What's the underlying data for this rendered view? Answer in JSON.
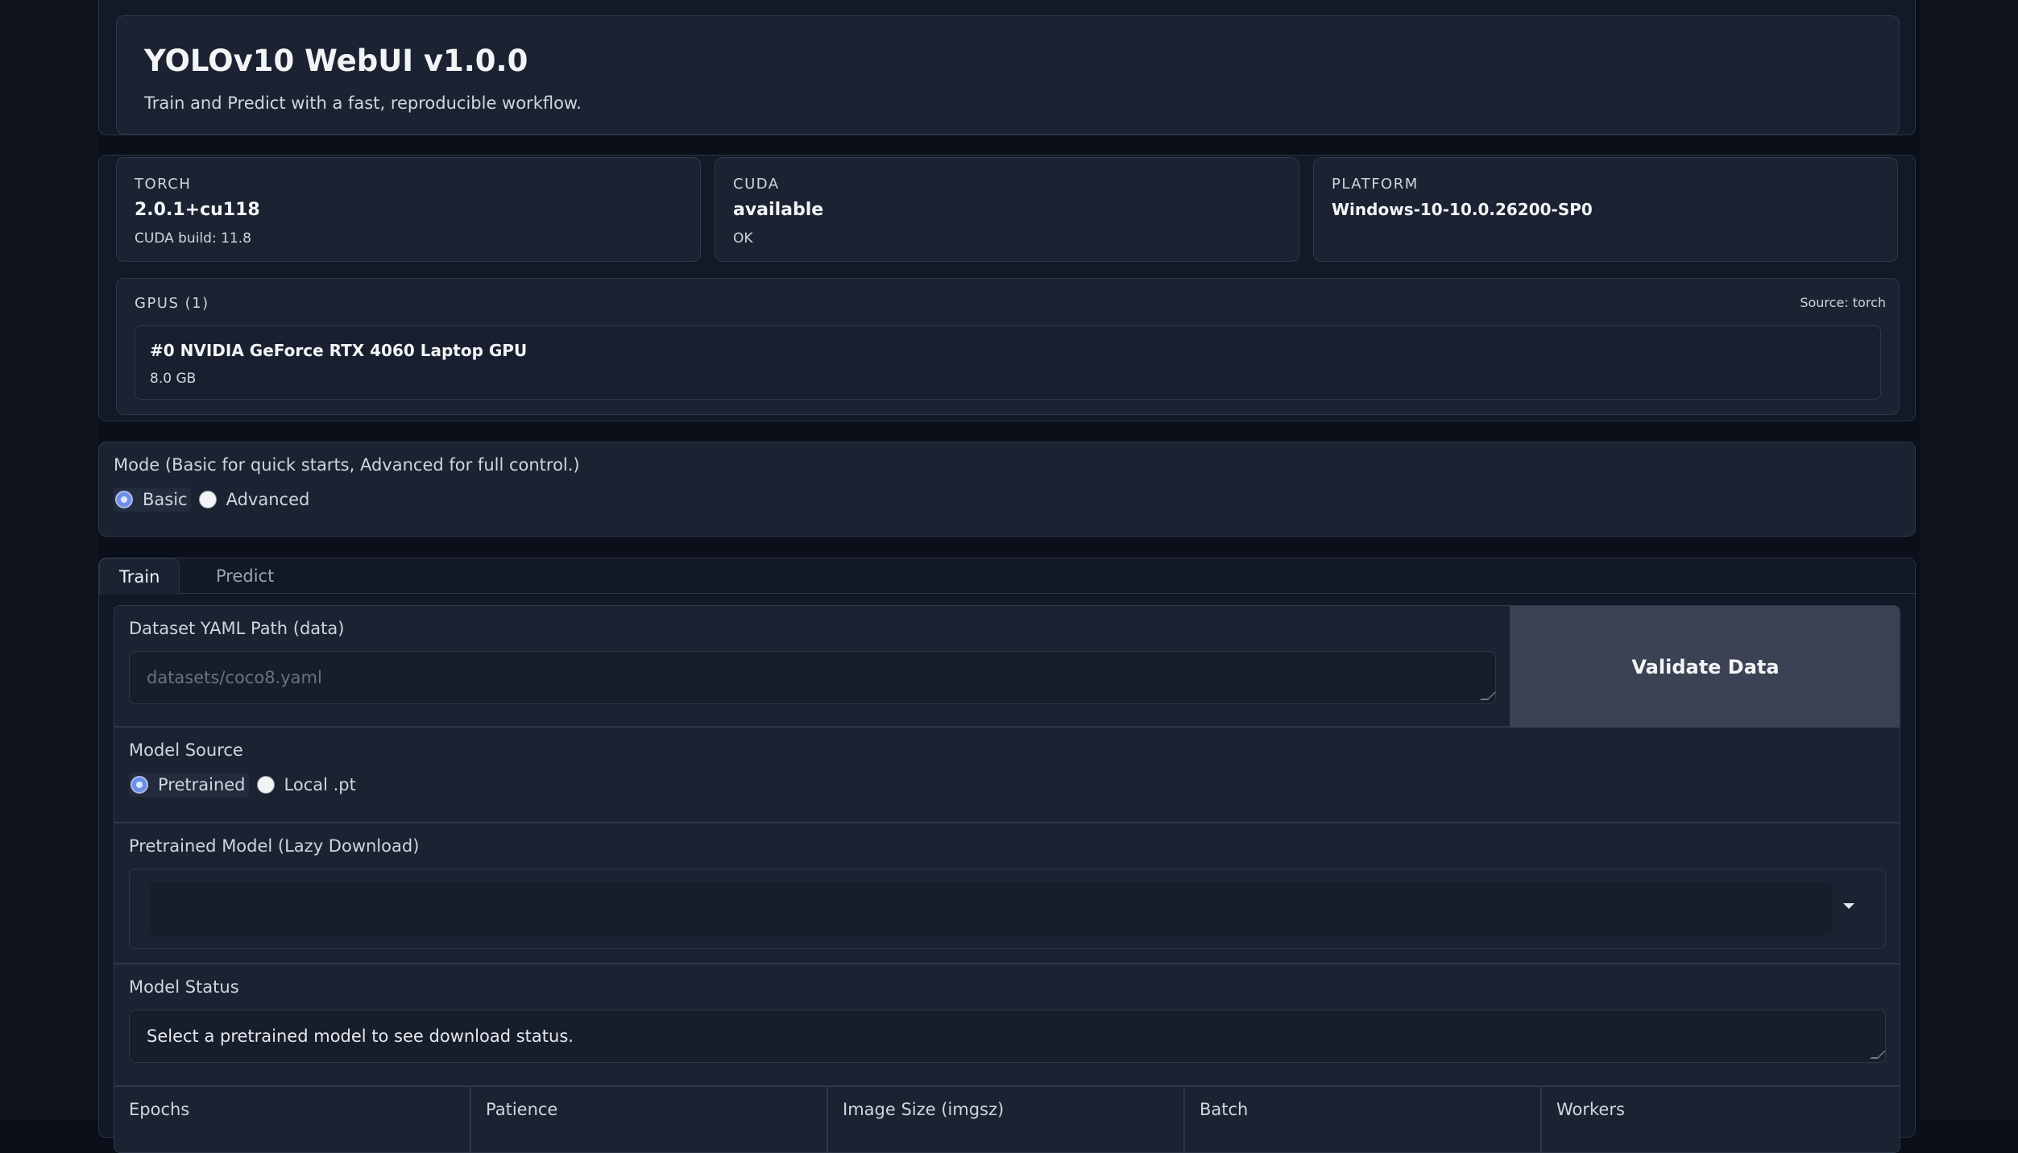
{
  "app": {
    "title": "YOLOv10 WebUI v1.0.0",
    "subtitle": "Train and Predict with a fast, reproducible workflow."
  },
  "env": {
    "torch": {
      "label": "TORCH",
      "value": "2.0.1+cu118",
      "sub": "CUDA build: 11.8"
    },
    "cuda": {
      "label": "CUDA",
      "value": "available",
      "sub": "OK"
    },
    "platform": {
      "label": "PLATFORM",
      "value": "Windows-10-10.0.26200-SP0"
    },
    "gpus": {
      "label": "GPUS (1)",
      "source": "Source: torch",
      "items": [
        {
          "name": "#0 NVIDIA GeForce RTX 4060 Laptop GPU",
          "memory": "8.0 GB"
        }
      ]
    }
  },
  "mode": {
    "label": "Mode (Basic for quick starts, Advanced for full control.)",
    "options": [
      "Basic",
      "Advanced"
    ],
    "selected": "Basic"
  },
  "tabs": [
    {
      "label": "Train",
      "active": true
    },
    {
      "label": "Predict",
      "active": false
    }
  ],
  "train": {
    "dataset": {
      "label": "Dataset YAML Path (data)",
      "placeholder": "datasets/coco8.yaml",
      "value": ""
    },
    "validate_button": "Validate Data",
    "model_source": {
      "label": "Model Source",
      "options": [
        "Pretrained",
        "Local .pt"
      ],
      "selected": "Pretrained"
    },
    "pretrained_model": {
      "label": "Pretrained Model (Lazy Download)",
      "value": ""
    },
    "model_status": {
      "label": "Model Status",
      "value": "Select a pretrained model to see download status."
    },
    "params": [
      "Epochs",
      "Patience",
      "Image Size (imgsz)",
      "Batch",
      "Workers"
    ]
  },
  "colors": {
    "background": "#0b0f19",
    "card": "#1b2333",
    "accent": "#6d8ee8",
    "button": "#3a4253"
  }
}
